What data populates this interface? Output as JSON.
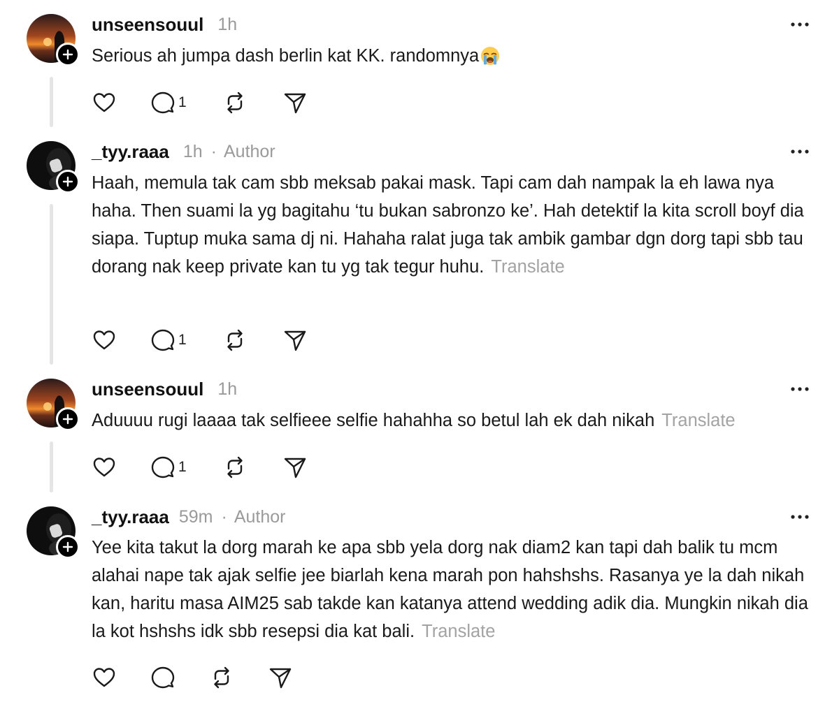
{
  "posts": [
    {
      "username": "unseensouul",
      "time": "1h",
      "author_tag": "",
      "text": "Serious ah jumpa dash berlin kat KK. randomnya",
      "emoji": "loudly-crying-face",
      "translate": "",
      "reply_count": "1"
    },
    {
      "username": "_tyy.raaa",
      "time": "1h",
      "author_tag": "Author",
      "text": "Haah, memula tak cam sbb meksab pakai mask. Tapi cam dah nampak la eh lawa nya haha. Then suami la yg bagitahu ‘tu bukan sabronzo ke’. Hah detektif la kita scroll boyf dia siapa. Tuptup muka sama dj ni. Hahaha ralat juga tak ambik gambar dgn dorg tapi sbb tau dorang nak keep private kan tu yg tak tegur huhu.",
      "translate": "Translate",
      "reply_count": "1"
    },
    {
      "username": "unseensouul",
      "time": "1h",
      "author_tag": "",
      "text": "Aduuuu rugi laaaa tak selfieee selfie hahahha so betul lah ek dah nikah",
      "translate": "Translate",
      "reply_count": "1"
    },
    {
      "username": "_tyy.raaa",
      "time": "59m",
      "author_tag": "Author",
      "text": "Yee kita takut la dorg marah ke apa sbb yela dorg nak diam2 kan tapi dah balik tu mcm alahai nape tak ajak selfie jee biarlah kena marah pon hahshshs. Rasanya ye la dah nikah kan, haritu masa AIM25 sab takde kan katanya attend wedding adik dia. Mungkin nikah dia la kot hshshs idk sbb resepsi dia kat bali.",
      "translate": "Translate",
      "reply_count": ""
    }
  ],
  "separator": "·",
  "icons": {
    "like": "heart-icon",
    "reply": "comment-icon",
    "repost": "repost-icon",
    "share": "send-icon",
    "more": "more-options-icon",
    "follow": "plus-icon"
  },
  "colors": {
    "text": "#111111",
    "muted": "#9a9a9a",
    "translate": "#a3a3a3",
    "thread_line": "#e5e5e5"
  }
}
